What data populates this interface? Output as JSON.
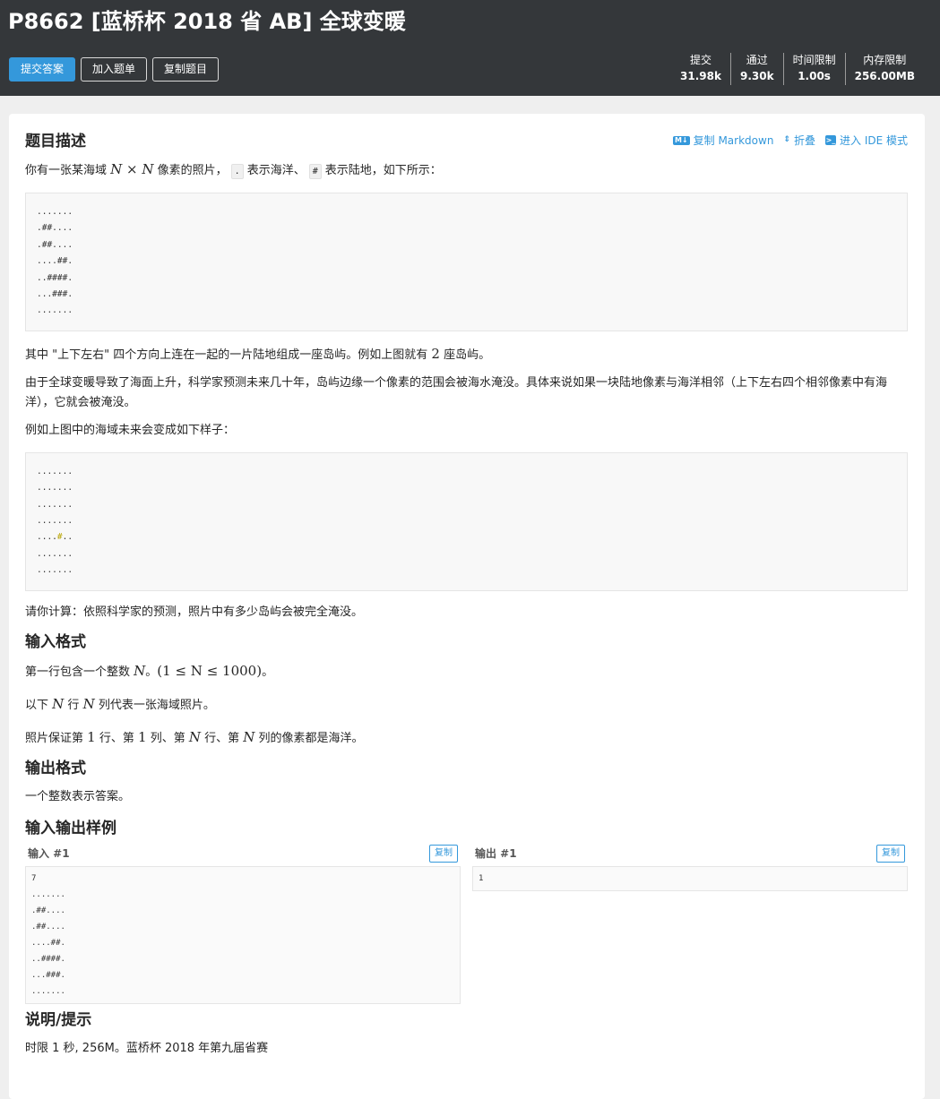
{
  "header": {
    "title": "P8662 [蓝桥杯 2018 省 AB] 全球变暖",
    "buttons": {
      "submit": "提交答案",
      "add_list": "加入题单",
      "copy_problem": "复制题目"
    },
    "stats": [
      {
        "label": "提交",
        "value": "31.98k"
      },
      {
        "label": "通过",
        "value": "9.30k"
      },
      {
        "label": "时间限制",
        "value": "1.00s"
      },
      {
        "label": "内存限制",
        "value": "256.00MB"
      }
    ]
  },
  "toolbar": {
    "copy_markdown": "复制 Markdown",
    "collapse": "折叠",
    "ide_mode": "进入 IDE 模式"
  },
  "description": {
    "heading": "题目描述",
    "p1_a": "你有一张某海域",
    "p1_math": "N × N",
    "p1_b": "像素的照片，",
    "p1_code1": ".",
    "p1_c": "表示海洋、",
    "p1_code2": "#",
    "p1_d": "表示陆地，如下所示：",
    "map1": ".......\n.##....\n.##....\n....##.\n..####.\n...###.\n.......",
    "p2_a": "其中 \"上下左右\" 四个方向上连在一起的一片陆地组成一座岛屿。例如上图就有",
    "p2_num": "2",
    "p2_b": "座岛屿。",
    "p3": "由于全球变暖导致了海面上升，科学家预测未来几十年，岛屿边缘一个像素的范围会被海水淹没。具体来说如果一块陆地像素与海洋相邻（上下左右四个相邻像素中有海洋），它就会被淹没。",
    "p4": "例如上图中的海域未来会变成如下样子：",
    "map2_top": ".......\n.......\n.......\n.......",
    "map2_row_a": "....",
    "map2_row_hash": "#",
    "map2_row_b": "..",
    "map2_bottom": ".......\n.......",
    "p5": "请你计算：依照科学家的预测，照片中有多少岛屿会被完全淹没。"
  },
  "input_format": {
    "heading": "输入格式",
    "l1_a": "第一行包含一个整数",
    "l1_var": "N",
    "l1_b": "。",
    "l1_constraint": "(1 ≤ N ≤ 1000)",
    "l1_c": "。",
    "l2_a": "以下",
    "l2_v1": "N",
    "l2_b": "行",
    "l2_v2": "N",
    "l2_c": "列代表一张海域照片。",
    "l3_a": "照片保证第",
    "l3_n1": "1",
    "l3_b": "行、第",
    "l3_n2": "1",
    "l3_c": "列、第",
    "l3_v1": "N",
    "l3_d": "行、第",
    "l3_v2": "N",
    "l3_e": "列的像素都是海洋。"
  },
  "output_format": {
    "heading": "输出格式",
    "text": "一个整数表示答案。"
  },
  "samples": {
    "heading": "输入输出样例",
    "input_title": "输入 #1",
    "output_title": "输出 #1",
    "copy_label": "复制",
    "input": "7\n.......\n.##....\n.##....\n....##.\n..####.\n...###.\n.......",
    "output": "1"
  },
  "hint": {
    "heading": "说明/提示",
    "text": "时限 1 秒, 256M。蓝桥杯 2018 年第九届省赛"
  },
  "colors": {
    "header_bg": "#34373a",
    "primary": "#3498db",
    "page_bg": "#efefef"
  }
}
